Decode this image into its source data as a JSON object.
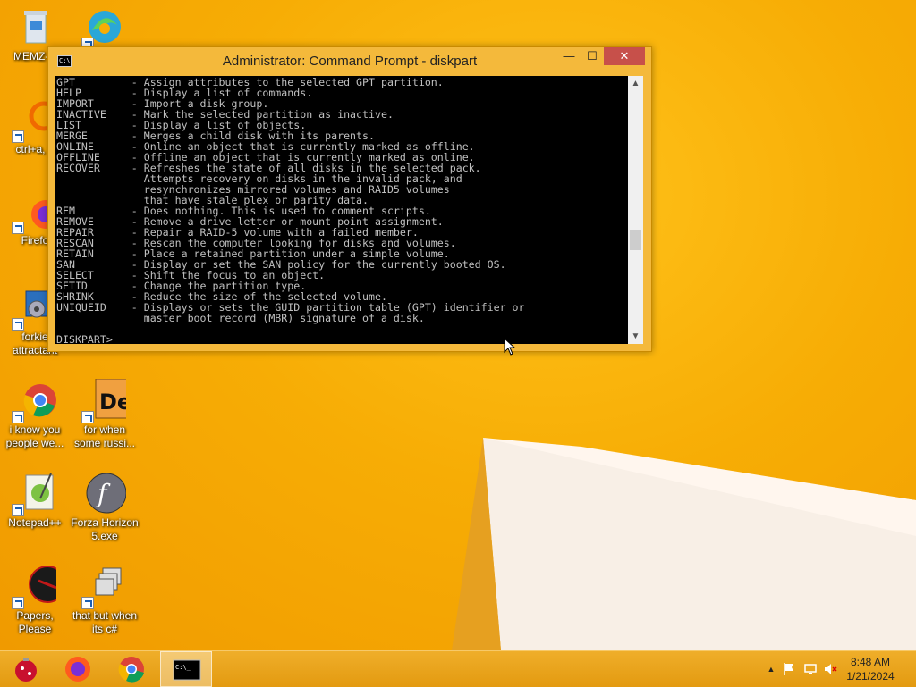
{
  "desktop": {
    "icons": [
      {
        "label": "MEMZ-D",
        "icon": "recycle-bin-icon"
      },
      {
        "label": "",
        "icon": "edge-icon"
      },
      {
        "label": "ctrl+a, e",
        "icon": "orange-ring-icon"
      },
      {
        "label": "Firefo",
        "icon": "firefox-icon"
      },
      {
        "label": "forkie attractant",
        "icon": "system-settings-icon"
      },
      {
        "label": "i know you people we...",
        "icon": "chrome-icon"
      },
      {
        "label": "for when some russi...",
        "icon": "de-app-icon"
      },
      {
        "label": "Notepad++",
        "icon": "notepad-plus-plus-icon"
      },
      {
        "label": "Forza Horizon 5.exe",
        "icon": "flash-icon"
      },
      {
        "label": "Papers, Please",
        "icon": "papers-please-icon"
      },
      {
        "label": "that but when its c#",
        "icon": "windows-stack-icon"
      }
    ]
  },
  "window": {
    "title": "Administrator: Command Prompt - diskpart",
    "minimize_label": "—",
    "maximize_label": "☐",
    "close_label": "✕",
    "console_lines": [
      "GPT         - Assign attributes to the selected GPT partition.",
      "HELP        - Display a list of commands.",
      "IMPORT      - Import a disk group.",
      "INACTIVE    - Mark the selected partition as inactive.",
      "LIST        - Display a list of objects.",
      "MERGE       - Merges a child disk with its parents.",
      "ONLINE      - Online an object that is currently marked as offline.",
      "OFFLINE     - Offline an object that is currently marked as online.",
      "RECOVER     - Refreshes the state of all disks in the selected pack.",
      "              Attempts recovery on disks in the invalid pack, and",
      "              resynchronizes mirrored volumes and RAID5 volumes",
      "              that have stale plex or parity data.",
      "REM         - Does nothing. This is used to comment scripts.",
      "REMOVE      - Remove a drive letter or mount point assignment.",
      "REPAIR      - Repair a RAID-5 volume with a failed member.",
      "RESCAN      - Rescan the computer looking for disks and volumes.",
      "RETAIN      - Place a retained partition under a simple volume.",
      "SAN         - Display or set the SAN policy for the currently booted OS.",
      "SELECT      - Shift the focus to an object.",
      "SETID       - Change the partition type.",
      "SHRINK      - Reduce the size of the selected volume.",
      "UNIQUEID    - Displays or sets the GUID partition table (GPT) identifier or",
      "              master boot record (MBR) signature of a disk.",
      "",
      "DISKPART> "
    ],
    "scroll_up": "▲",
    "scroll_down": "▼"
  },
  "taskbar": {
    "apps": [
      {
        "name": "christmas-ornament-app",
        "icon": "ornament-icon"
      },
      {
        "name": "firefox-app",
        "icon": "firefox-icon"
      },
      {
        "name": "chrome-app",
        "icon": "chrome-icon"
      },
      {
        "name": "command-prompt-app",
        "icon": "cmd-icon"
      }
    ],
    "tray": {
      "show_hidden": "▲",
      "time": "8:48 AM",
      "date": "1/21/2024"
    }
  }
}
